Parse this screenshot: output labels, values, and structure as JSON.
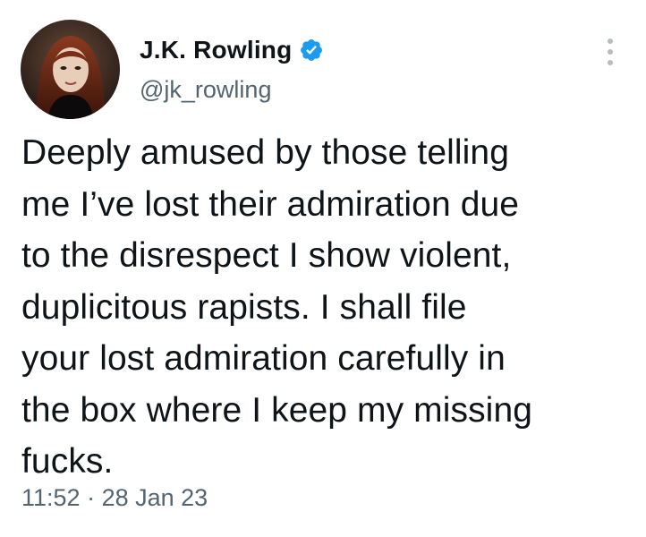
{
  "author": {
    "display_name": "J.K. Rowling",
    "handle": "@jk_rowling",
    "verified": true,
    "verified_color": "#1d9bf0"
  },
  "tweet": {
    "text": "Deeply amused by those telling\nme I’ve lost their admiration due\nto the disrespect I show violent,\nduplicitous rapists. I shall file\nyour lost admiration carefully in\nthe box where I keep my missing\nfucks.",
    "time": "11:52",
    "separator": "·",
    "date": "28 Jan 23"
  },
  "icons": {
    "verified": "verified-badge-icon",
    "more": "more-options-icon"
  }
}
